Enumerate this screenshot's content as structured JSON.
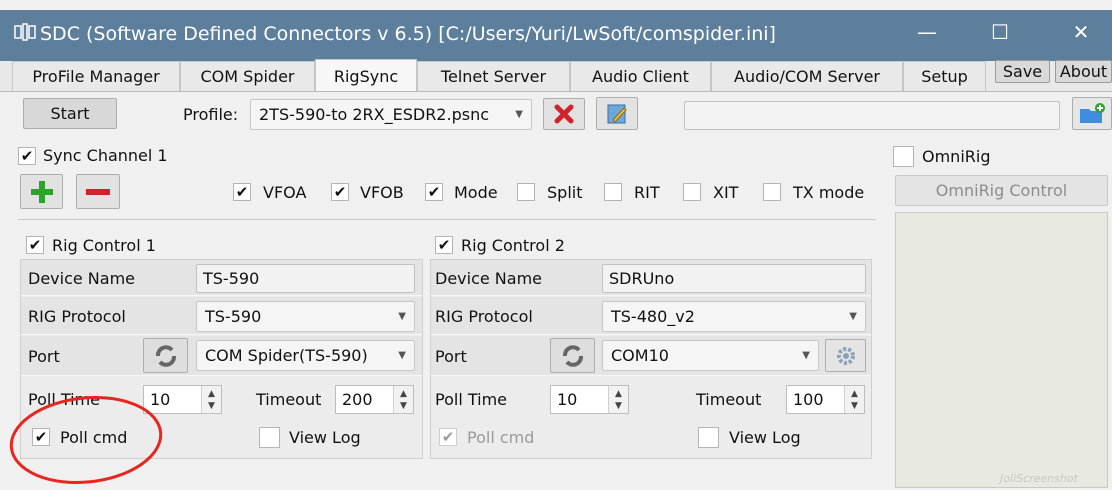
{
  "window": {
    "title": "SDC (Software Defined Connectors v 6.5) [C:/Users/Yuri/LwSoft/comspider.ini]",
    "minimize": "—",
    "maximize": "☐",
    "close": "✕"
  },
  "tabs": [
    {
      "label": "ProFile Manager"
    },
    {
      "label": "COM Spider"
    },
    {
      "label": "RigSync"
    },
    {
      "label": "Telnet Server"
    },
    {
      "label": "Audio Client"
    },
    {
      "label": "Audio/COM Server"
    },
    {
      "label": "Setup"
    }
  ],
  "top_buttons": {
    "save": "Save",
    "about": "About"
  },
  "toolbar": {
    "start": "Start",
    "profile_label": "Profile:",
    "profile_value": "2TS-590-to 2RX_ESDR2.psnc",
    "status_text": ""
  },
  "sync_channel": {
    "label": "Sync Channel 1",
    "checked": "✔",
    "add": "+",
    "remove": "−",
    "options": [
      {
        "label": "VFOA",
        "mark": "✔"
      },
      {
        "label": "VFOB",
        "mark": "✔"
      },
      {
        "label": "Mode",
        "mark": "✔"
      },
      {
        "label": "Split",
        "mark": ""
      },
      {
        "label": "RIT",
        "mark": ""
      },
      {
        "label": "XIT",
        "mark": ""
      },
      {
        "label": "TX mode",
        "mark": ""
      }
    ]
  },
  "rig1": {
    "header": "Rig Control 1",
    "mark": "✔",
    "device_name_label": "Device Name",
    "device_name": "TS-590",
    "protocol_label": "RIG Protocol",
    "protocol": "TS-590",
    "port_label": "Port",
    "port": "COM Spider(TS-590)",
    "poll_time_label": "Poll Time",
    "poll_time": "10",
    "timeout_label": "Timeout",
    "timeout": "200",
    "poll_cmd_label": "Poll cmd",
    "poll_cmd_mark": "✔",
    "view_log_label": "View Log"
  },
  "rig2": {
    "header": "Rig Control 2",
    "mark": "✔",
    "device_name_label": "Device Name",
    "device_name": "SDRUno",
    "protocol_label": "RIG Protocol",
    "protocol": "TS-480_v2",
    "port_label": "Port",
    "port": "COM10",
    "poll_time_label": "Poll Time",
    "poll_time": "10",
    "timeout_label": "Timeout",
    "timeout": "100",
    "poll_cmd_label": "Poll cmd",
    "poll_cmd_mark": "✔",
    "view_log_label": "View Log"
  },
  "omnirig": {
    "label": "OmniRig",
    "control_button": "OmniRig Control"
  },
  "watermark": "JoliScreenshot",
  "colors": {
    "titlebar": "#5d7f9c",
    "annotation": "#e8251f",
    "add_green": "#2aa52a",
    "remove_red": "#d21f2a"
  }
}
